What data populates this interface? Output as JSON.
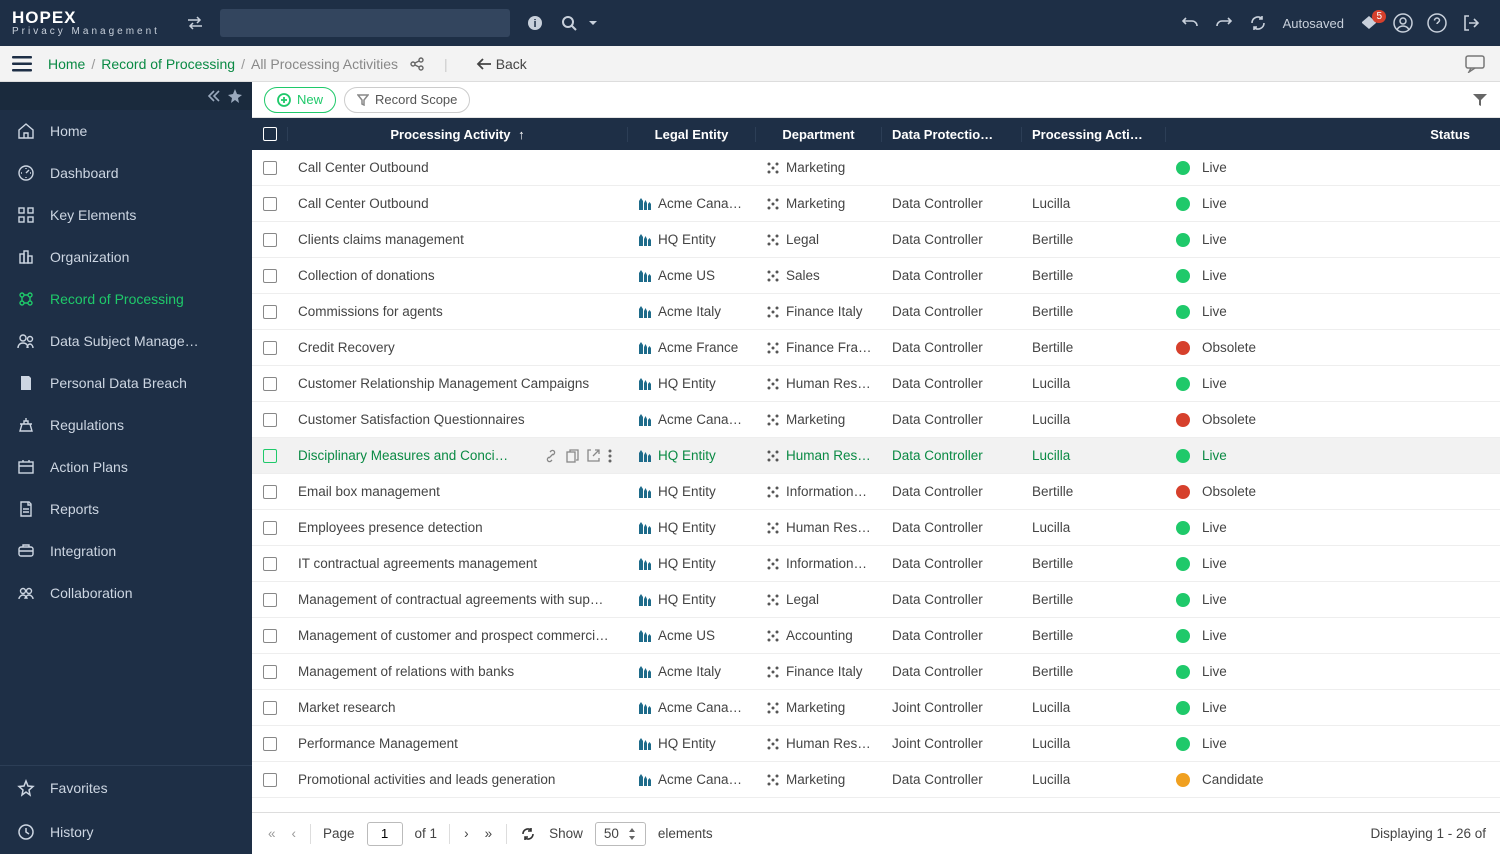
{
  "brand": {
    "main": "HOPEX",
    "sub": "Privacy Management"
  },
  "topbar": {
    "autosaved": "Autosaved",
    "notif_count": "5"
  },
  "breadcrumb": {
    "home": "Home",
    "parent": "Record of Processing",
    "current": "All Processing Activities",
    "back": "Back"
  },
  "sidebar": {
    "items": [
      {
        "label": "Home"
      },
      {
        "label": "Dashboard"
      },
      {
        "label": "Key Elements"
      },
      {
        "label": "Organization"
      },
      {
        "label": "Record of Processing"
      },
      {
        "label": "Data Subject Manage…"
      },
      {
        "label": "Personal Data Breach"
      },
      {
        "label": "Regulations"
      },
      {
        "label": "Action Plans"
      },
      {
        "label": "Reports"
      },
      {
        "label": "Integration"
      },
      {
        "label": "Collaboration"
      }
    ],
    "bottom": [
      {
        "label": "Favorites"
      },
      {
        "label": "History"
      }
    ]
  },
  "toolbar": {
    "new_label": "New",
    "scope_label": "Record Scope"
  },
  "columns": {
    "activity": "Processing Activity",
    "entity": "Legal Entity",
    "dept": "Department",
    "dpo": "Data Protectio…",
    "owner": "Processing Acti…",
    "status": "Status"
  },
  "rows": [
    {
      "activity": "Call Center Outbound",
      "entity": "",
      "dept": "Marketing",
      "dpo": "",
      "owner": "",
      "status": "Live",
      "st": "live"
    },
    {
      "activity": "Call Center Outbound",
      "entity": "Acme Cana…",
      "dept": "Marketing",
      "dpo": "Data Controller",
      "owner": "Lucilla",
      "status": "Live",
      "st": "live"
    },
    {
      "activity": "Clients claims management",
      "entity": "HQ Entity",
      "dept": "Legal",
      "dpo": "Data Controller",
      "owner": "Bertille",
      "status": "Live",
      "st": "live"
    },
    {
      "activity": "Collection of donations",
      "entity": "Acme US",
      "dept": "Sales",
      "dpo": "Data Controller",
      "owner": "Bertille",
      "status": "Live",
      "st": "live"
    },
    {
      "activity": "Commissions for agents",
      "entity": "Acme Italy",
      "dept": "Finance Italy",
      "dpo": "Data Controller",
      "owner": "Bertille",
      "status": "Live",
      "st": "live"
    },
    {
      "activity": "Credit Recovery",
      "entity": "Acme France",
      "dept": "Finance Fra…",
      "dpo": "Data Controller",
      "owner": "Bertille",
      "status": "Obsolete",
      "st": "obs"
    },
    {
      "activity": "Customer Relationship Management Campaigns",
      "entity": "HQ Entity",
      "dept": "Human Res…",
      "dpo": "Data Controller",
      "owner": "Lucilla",
      "status": "Live",
      "st": "live"
    },
    {
      "activity": "Customer Satisfaction Questionnaires",
      "entity": "Acme Cana…",
      "dept": "Marketing",
      "dpo": "Data Controller",
      "owner": "Lucilla",
      "status": "Obsolete",
      "st": "obs"
    },
    {
      "activity": "Disciplinary Measures and Conci…",
      "entity": "HQ Entity",
      "dept": "Human Res…",
      "dpo": "Data Controller",
      "owner": "Lucilla",
      "status": "Live",
      "st": "live",
      "hl": true
    },
    {
      "activity": "Email box management",
      "entity": "HQ Entity",
      "dept": "Information…",
      "dpo": "Data Controller",
      "owner": "Bertille",
      "status": "Obsolete",
      "st": "obs"
    },
    {
      "activity": "Employees presence detection",
      "entity": "HQ Entity",
      "dept": "Human Res…",
      "dpo": "Data Controller",
      "owner": "Lucilla",
      "status": "Live",
      "st": "live"
    },
    {
      "activity": "IT contractual agreements management",
      "entity": "HQ Entity",
      "dept": "Information…",
      "dpo": "Data Controller",
      "owner": "Bertille",
      "status": "Live",
      "st": "live"
    },
    {
      "activity": "Management of contractual agreements with sup…",
      "entity": "HQ Entity",
      "dept": "Legal",
      "dpo": "Data Controller",
      "owner": "Bertille",
      "status": "Live",
      "st": "live"
    },
    {
      "activity": "Management of customer and prospect commerci…",
      "entity": "Acme US",
      "dept": "Accounting",
      "dpo": "Data Controller",
      "owner": "Bertille",
      "status": "Live",
      "st": "live"
    },
    {
      "activity": "Management of relations with banks",
      "entity": "Acme Italy",
      "dept": "Finance Italy",
      "dpo": "Data Controller",
      "owner": "Bertille",
      "status": "Live",
      "st": "live"
    },
    {
      "activity": "Market research",
      "entity": "Acme Cana…",
      "dept": "Marketing",
      "dpo": "Joint Controller",
      "owner": "Lucilla",
      "status": "Live",
      "st": "live"
    },
    {
      "activity": "Performance Management",
      "entity": "HQ Entity",
      "dept": "Human Res…",
      "dpo": "Joint Controller",
      "owner": "Lucilla",
      "status": "Live",
      "st": "live"
    },
    {
      "activity": "Promotional activities and leads generation",
      "entity": "Acme Cana…",
      "dept": "Marketing",
      "dpo": "Data Controller",
      "owner": "Lucilla",
      "status": "Candidate",
      "st": "cand"
    }
  ],
  "pager": {
    "page_label": "Page",
    "page_value": "1",
    "of": "of 1",
    "show": "Show",
    "size": "50",
    "elements": "elements",
    "display": "Displaying 1 - 26 of"
  }
}
